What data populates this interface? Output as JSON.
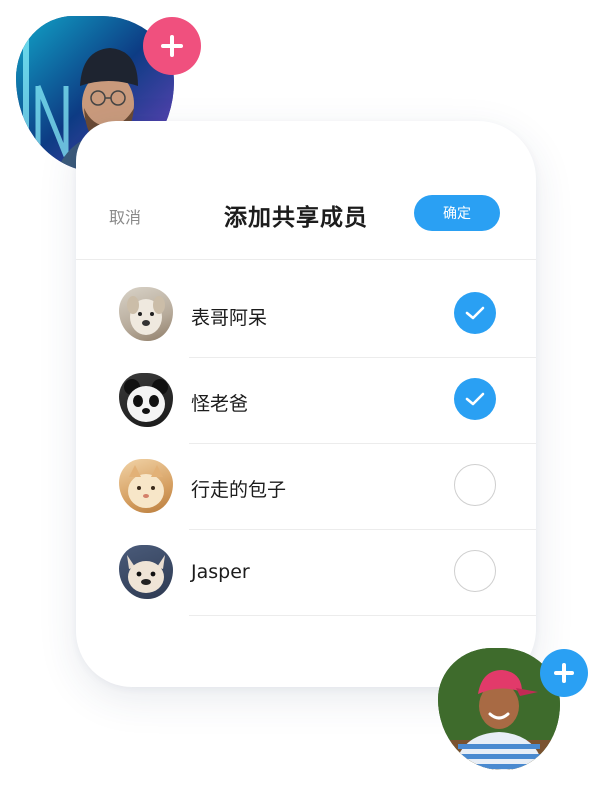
{
  "header": {
    "cancel_label": "取消",
    "title": "添加共享成员",
    "confirm_label": "确定"
  },
  "members": [
    {
      "name": "表哥阿呆",
      "selected": true,
      "avatar": "dog-avatar"
    },
    {
      "name": "怪老爸",
      "selected": true,
      "avatar": "panda-avatar"
    },
    {
      "name": "行走的包子",
      "selected": false,
      "avatar": "cat-avatar"
    },
    {
      "name": "Jasper",
      "selected": false,
      "avatar": "bulldog-avatar"
    }
  ],
  "floating": {
    "top_avatar": "man-with-beanie-avatar",
    "top_badge_icon": "plus-icon",
    "bottom_avatar": "boy-with-cap-avatar",
    "bottom_badge_icon": "plus-icon"
  },
  "colors": {
    "accent_blue": "#2aa0f3",
    "accent_pink": "#f0507e"
  }
}
